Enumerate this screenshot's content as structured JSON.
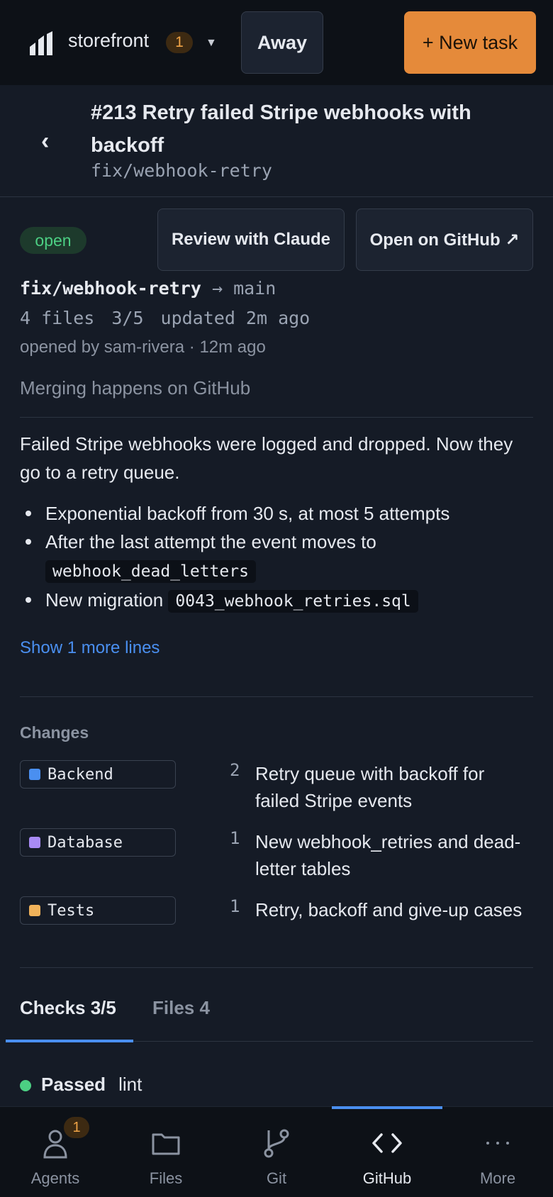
{
  "topbar": {
    "workspace_name": "storefront",
    "workspace_badge": "1",
    "away_label": "Away",
    "new_task_label": "+ New task",
    "colors": {
      "accent": "#e58a3a"
    }
  },
  "pr": {
    "title": "#213 Retry failed Stripe webhooks with backoff",
    "branch": "fix/webhook-retry",
    "status": "open",
    "review_label": "Review with Claude",
    "github_label": "Open on GitHub ↗",
    "source_branch": "fix/webhook-retry",
    "arrow": "→",
    "target_branch": "main",
    "files_text": "4 files",
    "checks_text": "3/5",
    "updated_text": "updated 2m ago",
    "opened_text": "opened by sam-rivera · 12m ago",
    "merge_note": "Merging happens on GitHub"
  },
  "description": {
    "intro": "Failed Stripe webhooks were logged and dropped. Now they go to a retry queue.",
    "bullet1": "Exponential backoff from 30 s, at most 5 attempts",
    "bullet2_text": "After the last attempt the event moves to",
    "bullet2_code": "webhook_dead_letters",
    "bullet3_text": "New migration",
    "bullet3_code": "0043_webhook_retries.sql",
    "show_more": "Show 1 more lines"
  },
  "changes": {
    "label": "Changes",
    "items": [
      {
        "area": "Backend",
        "color": "#4a8ff0",
        "count": "2",
        "desc": "Retry queue with backoff for failed Stripe events"
      },
      {
        "area": "Database",
        "color": "#a98bf5",
        "count": "1",
        "desc": "New webhook_retries and dead-letter tables"
      },
      {
        "area": "Tests",
        "color": "#f0b25a",
        "count": "1",
        "desc": "Retry, backoff and give-up cases"
      }
    ]
  },
  "tabs": {
    "checks": "Checks 3/5",
    "files": "Files 4"
  },
  "checks": [
    {
      "status": "Passed",
      "name": "lint",
      "color": "#4ccf83"
    }
  ],
  "nav": {
    "items": [
      {
        "label": "Agents",
        "icon": "person-icon",
        "badge": "1"
      },
      {
        "label": "Files",
        "icon": "folder-icon"
      },
      {
        "label": "Git",
        "icon": "git-branch-icon"
      },
      {
        "label": "GitHub",
        "icon": "code-brackets-icon"
      },
      {
        "label": "More",
        "icon": "more-icon"
      }
    ],
    "active": "GitHub"
  }
}
